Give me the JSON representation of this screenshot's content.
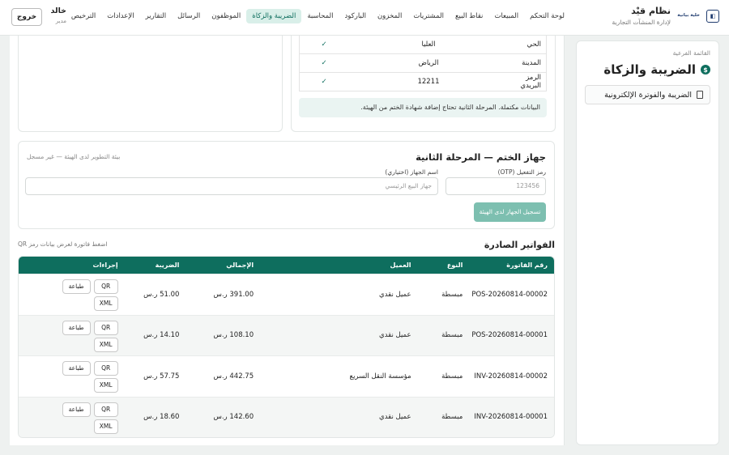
{
  "brand": {
    "logo_text": "خلية بيانية",
    "title": "نظام قيْد",
    "subtitle": "لإدارة المنشآت التجارية"
  },
  "nav": [
    "لوحة التحكم",
    "المبيعات",
    "نقاط البيع",
    "المشتريات",
    "المخزون",
    "الباركود",
    "المحاسبة",
    "الضريبة والزكاة",
    "الموظفون",
    "الرسائل",
    "التقارير",
    "الإعدادات",
    "الترخيص"
  ],
  "user": {
    "name": "خالد",
    "role": "مدير",
    "logout": "خروج"
  },
  "sidebar": {
    "label": "القائمة الفرعية",
    "title": "الضريبة والزكاة",
    "item": "الضريبة والفوترة الإلكترونية"
  },
  "address": [
    {
      "key": "الحي",
      "value": "العليا",
      "check": "✓"
    },
    {
      "key": "المدينة",
      "value": "الرياض",
      "check": "✓"
    },
    {
      "key": "الرمز البريدي",
      "value": "12211",
      "check": "✓"
    }
  ],
  "notice": "البيانات مكتملة. المرحلة الثانية تحتاج إضافة شهادة الختم من الهيئة.",
  "device": {
    "title": "جهاز الختم — المرحلة الثانية",
    "meta": "بيئة التطوير لدى الهيئة — غير مسجل",
    "otp_label": "رمز التفعيل (OTP)",
    "otp_placeholder": "123456",
    "name_label": "اسم الجهاز (اختياري)",
    "name_placeholder": "جهاز البيع الرئيسي",
    "register": "تسجيل الجهاز لدى الهيئة"
  },
  "invoices": {
    "title": "الفواتير الصادرة",
    "hint": "اضغط فاتورة لعرض بيانات رمز QR",
    "headers": [
      "رقم الفاتورة",
      "النوع",
      "العميل",
      "الإجمالي",
      "الضريبة",
      "إجراءات"
    ],
    "actions": {
      "qr": "QR",
      "print": "طباعة",
      "xml": "XML"
    },
    "rows": [
      {
        "num": "POS-20260814-00002",
        "type": "مبسطة",
        "customer": "عميل نقدي",
        "total": "391.00 ر.س",
        "tax": "51.00 ر.س"
      },
      {
        "num": "POS-20260814-00001",
        "type": "مبسطة",
        "customer": "عميل نقدي",
        "total": "108.10 ر.س",
        "tax": "14.10 ر.س"
      },
      {
        "num": "INV-20260814-00002",
        "type": "مبسطة",
        "customer": "مؤسسة النقل السريع",
        "total": "442.75 ر.س",
        "tax": "57.75 ر.س"
      },
      {
        "num": "INV-20260814-00001",
        "type": "مبسطة",
        "customer": "عميل نقدي",
        "total": "142.60 ر.س",
        "tax": "18.60 ر.س"
      }
    ]
  }
}
